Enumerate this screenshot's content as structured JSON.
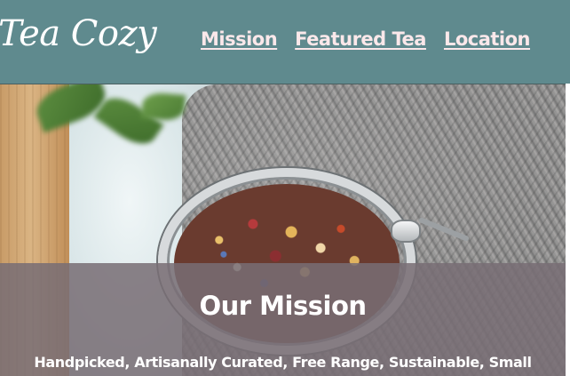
{
  "header": {
    "logo_text": "Tea Cozy",
    "nav": [
      {
        "label": "Mission"
      },
      {
        "label": "Featured Tea"
      },
      {
        "label": "Location"
      }
    ]
  },
  "hero": {
    "mission_title": "Our Mission",
    "mission_text": "Handpicked, Artisanally Curated, Free Range, Sustainable, Small"
  },
  "colors": {
    "header_background": "#5f8a8e",
    "nav_link": "#fbe8ea",
    "mission_panel": "#786e74",
    "text_light": "#ffffff"
  }
}
